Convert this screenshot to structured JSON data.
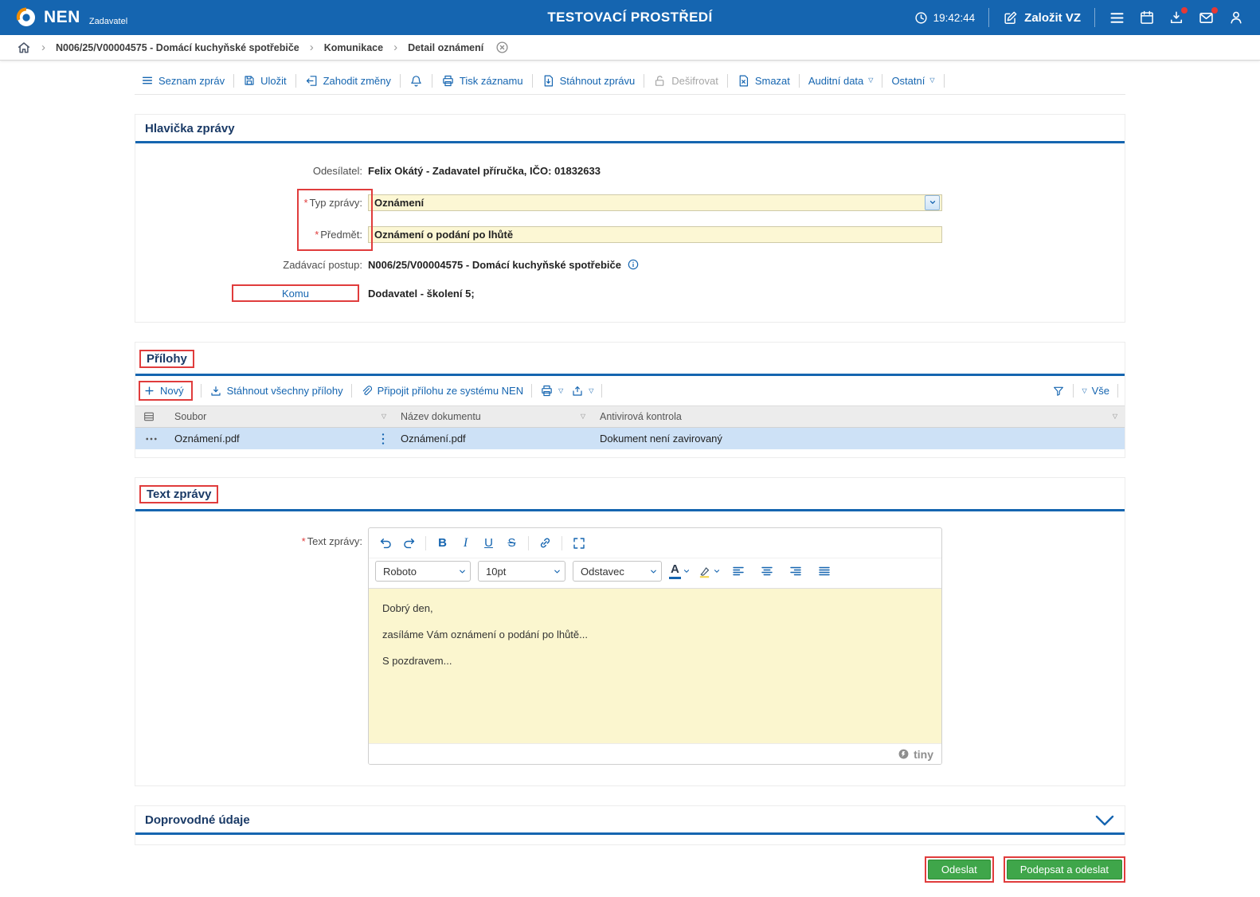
{
  "icons": {
    "required": "*",
    "caret": "▽",
    "crumb_sep": "›",
    "bold": "B",
    "italic": "I",
    "underline": "U",
    "strike": "S",
    "font_color_letter": "A"
  },
  "header": {
    "brand": "NEN",
    "brand_sub": "Zadavatel",
    "env_title": "TESTOVACÍ PROSTŘEDÍ",
    "time": "19:42:44",
    "new_vz_label": "Založit VZ"
  },
  "breadcrumb": {
    "items": [
      "N006/25/V00004575 - Domácí kuchyňské spotřebiče",
      "Komunikace",
      "Detail oznámení"
    ]
  },
  "toolbar": {
    "list": "Seznam zpráv",
    "save": "Uložit",
    "discard": "Zahodit změny",
    "print": "Tisk záznamu",
    "download": "Stáhnout zprávu",
    "decrypt": "Dešifrovat",
    "delete": "Smazat",
    "audit": "Auditní data",
    "other": "Ostatní"
  },
  "message_header": {
    "section_title": "Hlavička zprávy",
    "sender_label": "Odesílatel:",
    "sender_value": "Felix Okátý - Zadavatel příručka, IČO: 01832633",
    "type_label": "Typ zprávy:",
    "type_value": "Oznámení",
    "subject_label": "Předmět:",
    "subject_value": "Oznámení o podání po lhůtě",
    "procedure_label": "Zadávací postup:",
    "procedure_value": "N006/25/V00004575 - Domácí kuchyňské spotřebiče",
    "to_label": "Komu",
    "to_value": "Dodavatel - školení 5;"
  },
  "attachments": {
    "section_title": "Přílohy",
    "new_label": "Nový",
    "download_all": "Stáhnout všechny přílohy",
    "attach_from_nen": "Připojit přílohu ze systému NEN",
    "all_label": "Vše",
    "columns": [
      "Soubor",
      "Název dokumentu",
      "Antivirová kontrola"
    ],
    "rows": [
      {
        "file": "Oznámení.pdf",
        "doc_name": "Oznámení.pdf",
        "antivirus": "Dokument není zavirovaný"
      }
    ]
  },
  "message_text": {
    "section_title": "Text zprávy",
    "field_label": "Text zprávy:",
    "editor": {
      "font_family": "Roboto",
      "font_size": "10pt",
      "block_format": "Odstavec",
      "lines": [
        "Dobrý den,",
        "zasíláme Vám oznámení o podání po lhůtě...",
        "S pozdravem..."
      ],
      "brand": "tiny"
    }
  },
  "additional": {
    "section_title": "Doprovodné údaje"
  },
  "actions": {
    "send": "Odeslat",
    "sign_and_send": "Podepsat a odeslat"
  }
}
